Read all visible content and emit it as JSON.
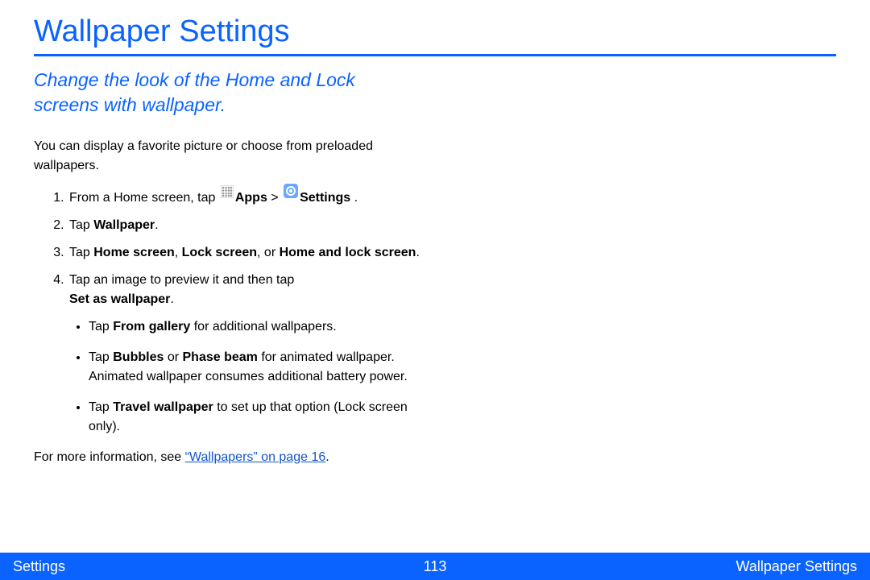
{
  "title": "Wallpaper Settings",
  "subtitle": "Change the look of the Home and Lock screens with wallpaper.",
  "intro": "You can display a favorite picture or choose from preloaded wallpapers.",
  "steps": {
    "s1_prefix": "From a Home screen, tap ",
    "s1_apps": "Apps",
    "s1_gt": " > ",
    "s1_settings": "Settings",
    "s1_suffix": " .",
    "s2_prefix": "Tap ",
    "s2_bold": "Wallpaper",
    "s2_suffix": ".",
    "s3_prefix": "Tap ",
    "s3_b1": "Home screen",
    "s3_sep1": ", ",
    "s3_b2": "Lock screen",
    "s3_sep2": ", or ",
    "s3_b3": "Home and lock screen",
    "s3_suffix": ".",
    "s4_line1": "Tap an image to preview it and then tap",
    "s4_bold": "Set as wallpaper",
    "s4_suffix": "."
  },
  "bullets": {
    "b1_prefix": "Tap ",
    "b1_bold": "From gallery",
    "b1_suffix": " for additional wallpapers.",
    "b2_prefix": "Tap ",
    "b2_bold1": "Bubbles",
    "b2_mid": " or ",
    "b2_bold2": "Phase beam",
    "b2_suffix": " for animated wallpaper. Animated wallpaper consumes additional battery power.",
    "b3_prefix": "Tap ",
    "b3_bold": "Travel wallpaper",
    "b3_suffix": " to set up that option (Lock screen only)."
  },
  "outro_prefix": "For more information, see ",
  "outro_link": "“Wallpapers” on page 16",
  "outro_suffix": ".",
  "footer": {
    "left": "Settings",
    "center": "113",
    "right": "Wallpaper Settings"
  }
}
